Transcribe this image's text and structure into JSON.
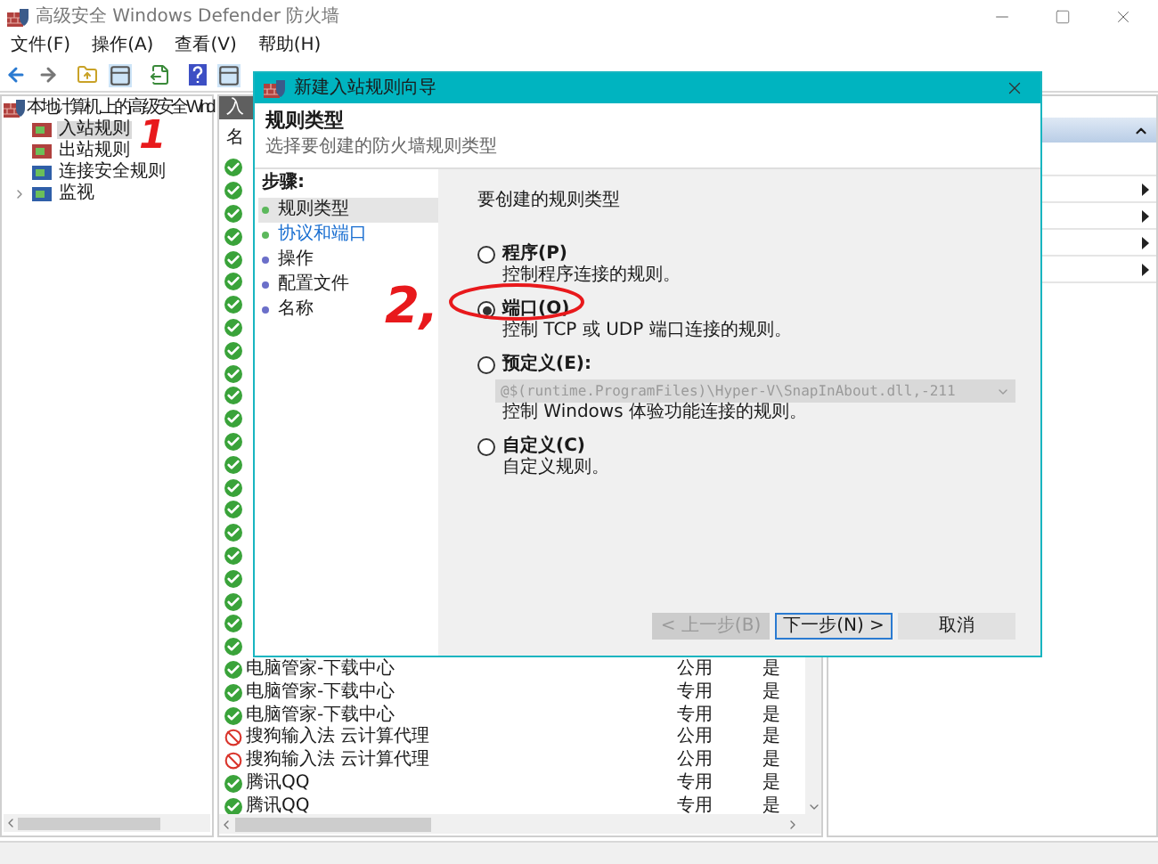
{
  "window": {
    "title": "高级安全 Windows Defender 防火墙"
  },
  "menu": [
    "文件(F)",
    "操作(A)",
    "查看(V)",
    "帮助(H)"
  ],
  "tree": {
    "label": "本地计算机 上的高级安全 Wind",
    "children": [
      {
        "label": "入站规则",
        "selected": true
      },
      {
        "label": "出站规则",
        "selected": false
      },
      {
        "label": "连接安全规则",
        "selected": false
      },
      {
        "label": "监视",
        "selected": false,
        "expanded": false
      }
    ]
  },
  "list": {
    "tab": "入",
    "columns": [
      "名"
    ],
    "rows": [
      {
        "kind": "allow"
      },
      {
        "kind": "allow"
      },
      {
        "kind": "allow"
      },
      {
        "kind": "allow"
      },
      {
        "kind": "allow"
      },
      {
        "kind": "allow"
      },
      {
        "kind": "allow"
      },
      {
        "kind": "allow"
      },
      {
        "kind": "allow"
      },
      {
        "kind": "allow"
      },
      {
        "kind": "allow"
      },
      {
        "kind": "allow"
      },
      {
        "kind": "allow"
      },
      {
        "kind": "allow"
      },
      {
        "kind": "allow"
      },
      {
        "kind": "allow"
      },
      {
        "kind": "allow"
      },
      {
        "kind": "allow"
      },
      {
        "kind": "allow"
      },
      {
        "kind": "allow"
      },
      {
        "kind": "allow"
      },
      {
        "kind": "allow"
      },
      {
        "kind": "allow",
        "name": "电脑管家-下载中心",
        "profile": "公用",
        "enabled": "是"
      },
      {
        "kind": "allow",
        "name": "电脑管家-下载中心",
        "profile": "专用",
        "enabled": "是"
      },
      {
        "kind": "allow",
        "name": "电脑管家-下载中心",
        "profile": "专用",
        "enabled": "是"
      },
      {
        "kind": "block",
        "name": "搜狗输入法 云计算代理",
        "profile": "公用",
        "enabled": "是"
      },
      {
        "kind": "block",
        "name": "搜狗输入法 云计算代理",
        "profile": "公用",
        "enabled": "是"
      },
      {
        "kind": "allow",
        "name": "腾讯QQ",
        "profile": "专用",
        "enabled": "是"
      },
      {
        "kind": "allow",
        "name": "腾讯QQ",
        "profile": "专用",
        "enabled": "是"
      }
    ]
  },
  "actions": {
    "header": {
      "expanded": true
    },
    "rows": [
      {
        "kind": "submenu"
      },
      {
        "kind": "submenu"
      },
      {
        "kind": "submenu"
      },
      {
        "kind": "submenu"
      }
    ]
  },
  "dialog": {
    "title": "新建入站规则向导",
    "heading": "规则类型",
    "subheading": "选择要创建的防火墙规则类型",
    "steps_title": "步骤:",
    "steps": [
      {
        "label": "规则类型",
        "selected": true,
        "kind": "text",
        "color": "#5cb85c"
      },
      {
        "label": "协议和端口",
        "selected": false,
        "kind": "link",
        "color": "#5cb85c"
      },
      {
        "label": "操作",
        "selected": false,
        "kind": "text",
        "color": "#6b6fc9"
      },
      {
        "label": "配置文件",
        "selected": false,
        "kind": "text",
        "color": "#6b6fc9"
      },
      {
        "label": "名称",
        "selected": false,
        "kind": "text",
        "color": "#6b6fc9"
      }
    ],
    "prompt": "要创建的规则类型",
    "options": [
      {
        "label": "程序(P)",
        "description": "控制程序连接的规则。",
        "selected": false
      },
      {
        "label": "端口(O)",
        "description": "控制 TCP 或 UDP 端口连接的规则。",
        "selected": true
      },
      {
        "label": "预定义(E):",
        "combo": {
          "value": "@$(runtime.ProgramFiles)\\Hyper-V\\SnapInAbout.dll,-211",
          "disabled": true
        },
        "description": "控制 Windows 体验功能连接的规则。",
        "selected": false
      },
      {
        "label": "自定义(C)",
        "description": "自定义规则。",
        "selected": false
      }
    ],
    "buttons": [
      {
        "label": "< 上一步(B)",
        "disabled": true,
        "focused": false
      },
      {
        "label": "下一步(N) >",
        "disabled": false,
        "focused": true
      },
      {
        "label": "取消",
        "disabled": false,
        "focused": false
      }
    ]
  },
  "annotations": [
    {
      "text": "1"
    },
    {
      "text": "2,"
    }
  ]
}
